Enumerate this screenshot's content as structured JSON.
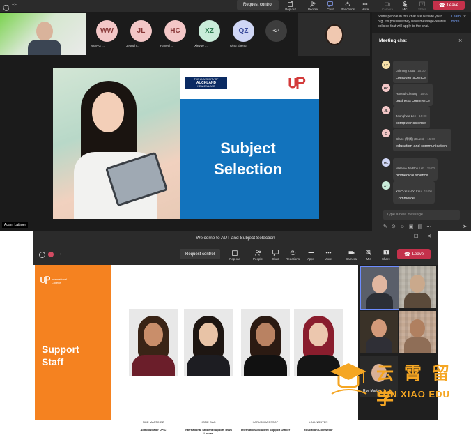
{
  "top_window": {
    "toolbar": {
      "timer": "--:--",
      "request_control": "Request control",
      "items": [
        {
          "label": "Pop out",
          "icon": "pop-out-icon"
        },
        {
          "label": "People",
          "icon": "people-icon"
        },
        {
          "label": "Chat",
          "icon": "chat-icon"
        },
        {
          "label": "Reactions",
          "icon": "reactions-icon"
        },
        {
          "label": "More",
          "icon": "more-icon"
        },
        {
          "label": "Camera",
          "icon": "camera-icon"
        },
        {
          "label": "Mic",
          "icon": "mic-icon"
        },
        {
          "label": "Share",
          "icon": "share-icon"
        }
      ],
      "leave": "Leave"
    },
    "participants": [
      {
        "initials": "WW",
        "name": "WANG ...",
        "color": "#f3c7c7"
      },
      {
        "initials": "JL",
        "name": "Jeongh...",
        "color": "#f3c7c7"
      },
      {
        "initials": "HC",
        "name": "Haneul ...",
        "color": "#f3c7c7"
      },
      {
        "initials": "XZ",
        "name": "Xieyue ...",
        "color": "#c9ecd9"
      },
      {
        "initials": "QZ",
        "name": "Qing Zheng",
        "color": "#cfd6f5"
      }
    ],
    "more_count": "+24",
    "slide": {
      "title_line1": "Subject",
      "title_line2": "Selection",
      "logo_text_1": "THE UNIVERSITY OF",
      "logo_text_2": "AUCKLAND",
      "logo_text_3": "NEW ZEALAND"
    },
    "presenter_name": "Adam Latimer",
    "chat": {
      "notice": "Some people in this chat are outside your org. It's possible they have message-related policies that will apply to the chat.",
      "notice_link": "Learn more",
      "title": "Meeting chat",
      "messages": [
        {
          "initials": "LZ",
          "name": "Leiming Zhao",
          "time": "15:00",
          "text": "computer science",
          "color": "#f7e0a8"
        },
        {
          "initials": "HC",
          "name": "Haneul Cheong",
          "time": "15:00",
          "text": "business commerce",
          "color": "#f3c7c7"
        },
        {
          "initials": "JL",
          "name": "Jeonghwa Lee",
          "time": "15:00",
          "text": "computer science",
          "color": "#f3c7c7"
        },
        {
          "initials": "C",
          "name": "Claire (单闻) (Guest)",
          "time": "15:00",
          "text": "education and communication",
          "color": "#f3c7c7"
        },
        {
          "initials": "ML",
          "name": "Melanie Jia Rou Lim",
          "time": "15:00",
          "text": "biomedical science",
          "color": "#cfd6f5"
        },
        {
          "initials": "XY",
          "name": "XIAO-XIAN YU Yu",
          "time": "15:00",
          "text": "Commerce",
          "color": "#c9ecd9"
        }
      ],
      "input_placeholder": "Type a new message"
    }
  },
  "bottom_window": {
    "title": "Welcome to AUT and Subject Selection",
    "timer": "--:--",
    "request_control": "Request control",
    "items": [
      {
        "label": "Pop out",
        "icon": "pop-out-icon"
      },
      {
        "label": "People",
        "icon": "people-icon"
      },
      {
        "label": "Chat",
        "icon": "chat-icon"
      },
      {
        "label": "Reactions",
        "icon": "reactions-icon"
      },
      {
        "label": "Apps",
        "icon": "apps-icon"
      },
      {
        "label": "More",
        "icon": "more-icon"
      },
      {
        "label": "Camera",
        "icon": "camera-icon"
      },
      {
        "label": "Mic",
        "icon": "mic-icon"
      },
      {
        "label": "Share",
        "icon": "share-icon"
      }
    ],
    "leave": "Leave",
    "slide": {
      "logo_line1": "International",
      "logo_line2": "College",
      "title_line1": "Support",
      "title_line2": "Staff",
      "staff": [
        {
          "name": "NOE MARTINEZ",
          "role": "Administrator UPIC"
        },
        {
          "name": "KATIE GAO",
          "role": "International Student Support Team Leader"
        },
        {
          "name": "KARUSHKA ESSOP",
          "role": "International Student Support Officer"
        },
        {
          "name": "LINA NGUYEN",
          "role": "Education Counsellor"
        }
      ]
    },
    "gallery_name": "Rue Martin"
  },
  "watermark": {
    "chinese": "云 霄 留 学",
    "english": "YUN XIAO EDU",
    "color": "#f5a623"
  }
}
